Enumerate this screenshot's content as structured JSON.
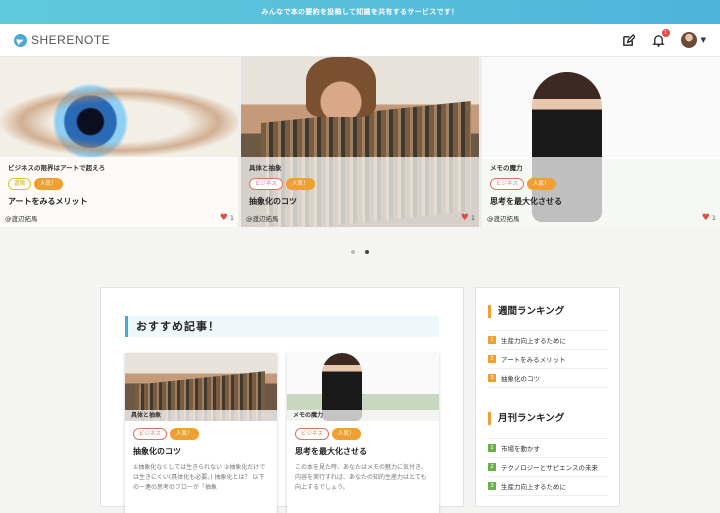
{
  "banner": {
    "text": "みんなで本の要約を投稿して知識を共有するサービスです！"
  },
  "header": {
    "logo_text": "SHERENOTE",
    "notification_count": "1",
    "icons": [
      "edit-icon",
      "bell-icon",
      "avatar"
    ]
  },
  "carousel": {
    "slides": [
      {
        "category": "ビジネスの限界はアートで超えろ",
        "tags": [
          "習慣",
          "人気！"
        ],
        "title": "アートをみるメリット",
        "author": "@渡辺拓馬",
        "likes": "1"
      },
      {
        "category": "具体と抽象",
        "tags": [
          "ビジネス",
          "人気！"
        ],
        "title": "抽象化のコツ",
        "author": "@渡辺拓馬",
        "likes": "1"
      },
      {
        "category": "メモの魔力",
        "tags": [
          "ビジネス",
          "人気！"
        ],
        "title": "思考を最大化させる",
        "author": "@渡辺拓馬",
        "likes": "1"
      }
    ],
    "active_dot": 2
  },
  "recommended": {
    "title": "おすすめ記事！",
    "cards": [
      {
        "category": "具体と抽象",
        "tags": [
          "ビジネス",
          "人気！"
        ],
        "title": "抽象化のコツ",
        "desc": "①抽象化なくしては生きられない ②抽象化だけでは生きにくい(具体化も必要。) 抽象化とは？ 以下の一連の思考のフローが「抽象"
      },
      {
        "category": "メモの魔力",
        "tags": [
          "ビジネス",
          "人気！"
        ],
        "title": "思考を最大化させる",
        "desc": "この本を見た時、あなたはメモの魅力に気付き、内容を実行すれば、あなたの知的生産力はとても向上するでしょう。"
      }
    ]
  },
  "weekly": {
    "title": "週間ランキング",
    "items": [
      {
        "rank": "1",
        "label": "生産力向上するために"
      },
      {
        "rank": "2",
        "label": "アートをみるメリット"
      },
      {
        "rank": "3",
        "label": "抽象化のコツ"
      }
    ]
  },
  "monthly": {
    "title": "月刊ランキング",
    "items": [
      {
        "rank": "1",
        "label": "市場を動かす"
      },
      {
        "rank": "2",
        "label": "テクノロジーとサピエンスの未来"
      },
      {
        "rank": "3",
        "label": "生産力向上するために"
      }
    ]
  },
  "colors": {
    "accent": "#4ba7d3",
    "popular": "#f0a030",
    "heart": "#e24a4a"
  }
}
